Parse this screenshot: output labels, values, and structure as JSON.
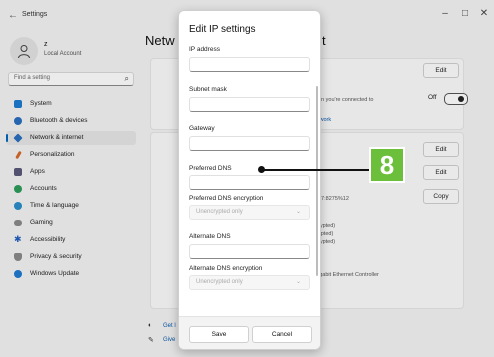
{
  "titlebar": {
    "back": "←",
    "title": "Settings",
    "minimize": "–",
    "maximize": "□",
    "close": "✕"
  },
  "account": {
    "name": "z",
    "type": "Local Account"
  },
  "search": {
    "placeholder": "Find a setting"
  },
  "nav": [
    {
      "label": "System",
      "color": "#1f7ad1"
    },
    {
      "label": "Bluetooth & devices",
      "color": "#2a6ebe"
    },
    {
      "label": "Network & internet",
      "color": "#2a6ebe",
      "active": true
    },
    {
      "label": "Personalization",
      "color": "#d66a2a"
    },
    {
      "label": "Apps",
      "color": "#5a5a7a"
    },
    {
      "label": "Accounts",
      "color": "#2d9c5a"
    },
    {
      "label": "Time & language",
      "color": "#2a8ec8"
    },
    {
      "label": "Gaming",
      "color": "#7b7b7b"
    },
    {
      "label": "Accessibility",
      "color": "#1f5fbf"
    },
    {
      "label": "Privacy & security",
      "color": "#7a7a7a"
    },
    {
      "label": "Windows Update",
      "color": "#1f7ad1"
    }
  ],
  "page": {
    "title_left": "Netw",
    "title_right": "t"
  },
  "right": {
    "edit1": "Edit",
    "connected_text": "en you're connected to",
    "off_label": "Off",
    "network_link": "twork",
    "edit2": "Edit",
    "edit3": "Edit",
    "copy": "Copy",
    "ipv6_fragment": "57:8275%12",
    "ypted1": "rypted)",
    "ypted2": "ypted)",
    "ypted3": "rypted)",
    "adapter": "igabit Ethernet Controller",
    "r_fragment": "r"
  },
  "footer": {
    "link1": "Get l",
    "link2": "Give"
  },
  "dialog": {
    "title": "Edit IP settings",
    "fields": {
      "ip_address": "IP address",
      "subnet_mask": "Subnet mask",
      "gateway": "Gateway",
      "preferred_dns": "Preferred DNS",
      "preferred_dns_encryption": "Preferred DNS encryption",
      "alternate_dns": "Alternate DNS",
      "alternate_dns_encryption": "Alternate DNS encryption"
    },
    "encryption_value": "Unencrypted only",
    "save": "Save",
    "cancel": "Cancel"
  },
  "callout": {
    "number": "8",
    "color": "#6cbf3a"
  }
}
